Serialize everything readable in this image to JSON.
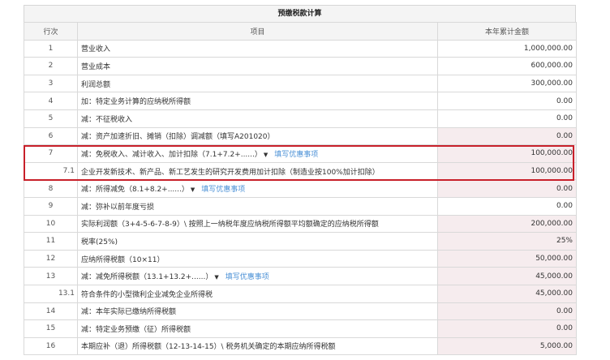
{
  "table": {
    "title": "预缴税款计算",
    "headers": {
      "no": "行次",
      "item": "项目",
      "amount": "本年累计金额"
    },
    "rows": [
      {
        "no": "1",
        "item": "营业收入",
        "amount": "1,000,000.00",
        "pink": false
      },
      {
        "no": "2",
        "item": "营业成本",
        "amount": "600,000.00",
        "pink": false
      },
      {
        "no": "3",
        "item": "利润总额",
        "amount": "300,000.00",
        "pink": false
      },
      {
        "no": "4",
        "item": "加：特定业务计算的应纳税所得额",
        "amount": "0.00",
        "pink": false
      },
      {
        "no": "5",
        "item": "减：不征税收入",
        "amount": "0.00",
        "pink": false
      },
      {
        "no": "6",
        "item": "减：资产加速折旧、摊销（扣除）调减额（填写A201020）",
        "amount": "0.00",
        "pink": true
      },
      {
        "no": "7",
        "item": "减：免税收入、减计收入、加计扣除（7.1+7.2+......）",
        "amount": "100,000.00",
        "pink": true,
        "dropdown": true,
        "link": "填写优惠事项"
      },
      {
        "no": "7.1",
        "item": "企业开发新技术、新产品、新工艺发生的研究开发费用加计扣除（制造业按100%加计扣除）",
        "amount": "100,000.00",
        "pink": true,
        "sub": true
      },
      {
        "no": "8",
        "item": "减：所得减免（8.1+8.2+......）",
        "amount": "0.00",
        "pink": true,
        "dropdown": true,
        "link": "填写优惠事项"
      },
      {
        "no": "9",
        "item": "减：弥补以前年度亏损",
        "amount": "0.00",
        "pink": false
      },
      {
        "no": "10",
        "item": "实际利润额（3+4-5-6-7-8-9）\\ 按照上一纳税年度应纳税所得额平均额确定的应纳税所得额",
        "amount": "200,000.00",
        "pink": true
      },
      {
        "no": "11",
        "item": "税率(25%)",
        "amount": "25%",
        "pink": true
      },
      {
        "no": "12",
        "item": "应纳所得税额（10×11）",
        "amount": "50,000.00",
        "pink": true
      },
      {
        "no": "13",
        "item": "减：减免所得税额（13.1+13.2+......）",
        "amount": "45,000.00",
        "pink": true,
        "dropdown": true,
        "link": "填写优惠事项"
      },
      {
        "no": "13.1",
        "item": "符合条件的小型微利企业减免企业所得税",
        "amount": "45,000.00",
        "pink": true,
        "sub": true
      },
      {
        "no": "14",
        "item": "减：本年实际已缴纳所得税额",
        "amount": "0.00",
        "pink": true
      },
      {
        "no": "15",
        "item": "减：特定业务预缴（征）所得税额",
        "amount": "0.00",
        "pink": true
      },
      {
        "no": "16",
        "item": "本期应补（退）所得税额（12-13-14-15）\\ 税务机关确定的本期应纳所得税额",
        "amount": "5,000.00",
        "pink": true
      }
    ]
  },
  "colors": {
    "highlight": "#c8202a",
    "link": "#4a90d6",
    "pink_cell": "#f6ecee"
  }
}
